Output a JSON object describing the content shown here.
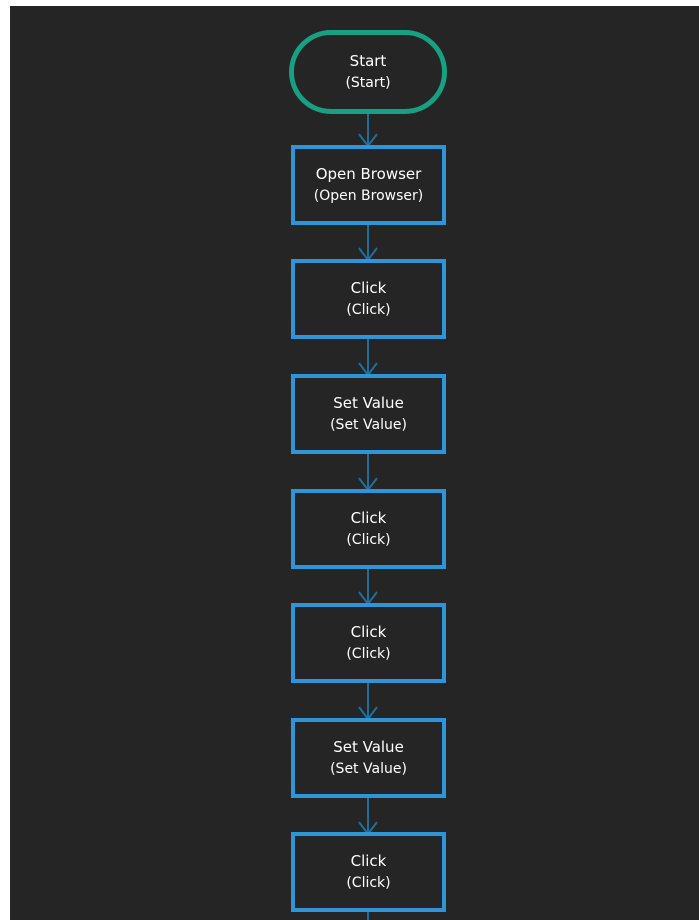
{
  "diagram": {
    "start": {
      "label": "Start",
      "sublabel": "(Start)"
    },
    "steps": [
      {
        "label": "Open Browser",
        "sublabel": "(Open Browser)"
      },
      {
        "label": "Click",
        "sublabel": "(Click)"
      },
      {
        "label": "Set Value",
        "sublabel": "(Set Value)"
      },
      {
        "label": "Click",
        "sublabel": "(Click)"
      },
      {
        "label": "Click",
        "sublabel": "(Click)"
      },
      {
        "label": "Set Value",
        "sublabel": "(Set Value)"
      },
      {
        "label": "Click",
        "sublabel": "(Click)"
      }
    ]
  },
  "colors": {
    "background": "#252525",
    "start_border": "#17a182",
    "action_border": "#2f95d8",
    "connector": "#1f6f9a",
    "text": "#ffffff"
  }
}
